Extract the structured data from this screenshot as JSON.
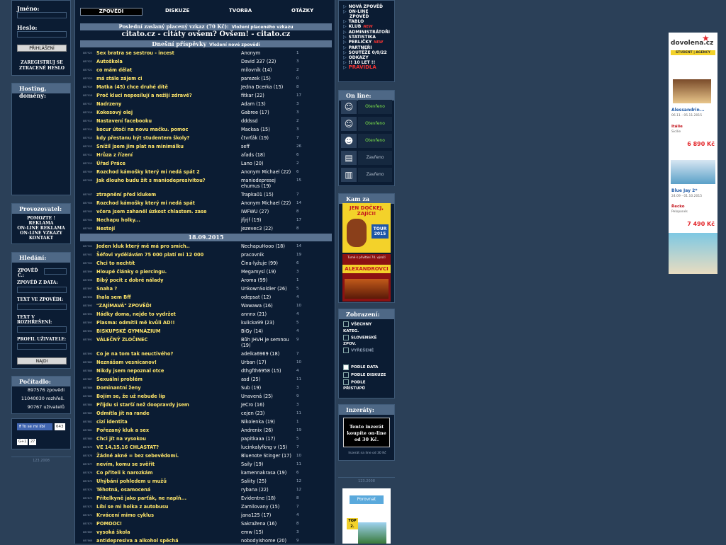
{
  "login": {
    "name_label": "Jméno:",
    "pass_label": "Heslo:",
    "login_btn": "PŘIHLÁŠENÍ",
    "register": "ZAREGISTRUJ SE",
    "forgot": "ZTRACENÉ HESLO"
  },
  "hosting": {
    "title": "Hosting,",
    "title2": "domény:"
  },
  "provider": {
    "title": "Provozovatel:",
    "links": [
      "POMOZTE !",
      "REKLAMA",
      "ON-LINE REKLAMA",
      "ON-LINE VZKAZY",
      "KONTAKT"
    ]
  },
  "search": {
    "title": "Hledání:",
    "f1": "ZPOVĚĎ Č.:",
    "f2": "ZPOVĚĎ Z DATA:",
    "f3": "TEXT VE ZPOVĚDI:",
    "f4": "TEXT V ROZHŘEŠENÍ:",
    "f5": "PROFIL UŽIVATELE:",
    "btn": "NAJDI"
  },
  "counter": {
    "title": "Počítadlo:",
    "c1": "897576 zpovědi",
    "c2": "11040030 rozhřeš.",
    "c3": "90767 uživatelů"
  },
  "social": {
    "fb": "To se mi líbí",
    "fb_count": "643",
    "gplus": "G+1",
    "gplus_count": "27"
  },
  "left_footer": "123.2008",
  "nav": {
    "tabs": [
      "ZPOVĚDI",
      "DISKUZE",
      "TVORBA",
      "OTÁZKY"
    ]
  },
  "paid": {
    "title": "Poslední zaslaný placený vzkaz (70 Kč):",
    "insert": "Vložení placeného vzkazu",
    "text": "citato.cz - citáty ovšem? Ovšem! - citato.cz"
  },
  "today": {
    "title": "Dnešní příspěvky",
    "insert": "Vložení nové zpovědi"
  },
  "date_sep": "18.09.2015",
  "rows1": [
    {
      "id": "887923",
      "t": "Sex bratra se sestrou - incest",
      "a": "Anonym",
      "c": "1"
    },
    {
      "id": "887922",
      "t": "Autoškola",
      "a": "David 337 (22)",
      "c": "3"
    },
    {
      "id": "887921",
      "t": "co mám dělat",
      "a": "milovník (14)",
      "c": "2"
    },
    {
      "id": "887920",
      "t": "má stále zájem ci",
      "a": "parezek (15)",
      "c": "0"
    },
    {
      "id": "887919",
      "t": "Matka (45) chce druhé dítě",
      "a": "Jedna Dcerka (15)",
      "c": "8"
    },
    {
      "id": "887918",
      "t": "Proč kluci neposílují a nežijí zdravě?",
      "a": "fitkar (22)",
      "c": "17"
    },
    {
      "id": "887917",
      "t": "Nadrzeny",
      "a": "Adam (13)",
      "c": "3"
    },
    {
      "id": "887916",
      "t": "Kokosový olej",
      "a": "Gabree (17)",
      "c": "3"
    },
    {
      "id": "887915",
      "t": "Nastavení facebooku",
      "a": "dddssd",
      "c": "2"
    },
    {
      "id": "887914",
      "t": "kocur útočí na novu mačku. pomoc",
      "a": "Mackaa (15)",
      "c": "3"
    },
    {
      "id": "887913",
      "t": "kdy přestanu být studentem školy?",
      "a": "čtvrťák (19)",
      "c": "7"
    },
    {
      "id": "887912",
      "t": "Snížil jsem jim plat na minimálku",
      "a": "seff",
      "c": "26"
    },
    {
      "id": "887911",
      "t": "Hrůza z řízení",
      "a": "afads (18)",
      "c": "6"
    },
    {
      "id": "887910",
      "t": "Úřad Práce",
      "a": "Lano (20)",
      "c": "2"
    },
    {
      "id": "887909",
      "t": "Rozchod kámošky který mi nedá spát 2",
      "a": "Anonym Michael (22)",
      "c": "6"
    },
    {
      "id": "887908",
      "t": "Jak dlouho budu žít s maniodepresivitou?",
      "a": "maniodepresej",
      "a2": "ehumus (19)",
      "c": "15"
    },
    {
      "id": "887907",
      "t": "ztrapnění před klukem",
      "a": "Trapka01 (15)",
      "c": "7"
    },
    {
      "id": "887906",
      "t": "Rozchod kámošky který mi nedá spát",
      "a": "Anonym Michael (22)",
      "c": "14"
    },
    {
      "id": "887905",
      "t": "včera jsem zahaněl úzkost chlastem. zase",
      "a": "IWFWU (27)",
      "c": "8"
    },
    {
      "id": "887904",
      "t": "Nechapu holky...",
      "a": "jfjrjf (19)",
      "c": "17"
    },
    {
      "id": "887903",
      "t": "Nestojí",
      "a": "Jezevec3 (22)",
      "c": "8"
    }
  ],
  "rows2": [
    {
      "id": "887902",
      "t": "Jeden kluk který mě má pro smích..",
      "a": "NechapuHooo (18)",
      "c": "14"
    },
    {
      "id": "887901",
      "t": "Šéfovi vydělávám 75 000 platí mi 12 000",
      "a": "pracovnik",
      "c": "19"
    },
    {
      "id": "887900",
      "t": "Chci to nechtít",
      "a": "Čina-lyžuje (99)",
      "c": "6"
    },
    {
      "id": "887899",
      "t": "Hloupé články o piercingu.",
      "a": "Megamysl (19)",
      "c": "3"
    },
    {
      "id": "887898",
      "t": "Bibý pocit z dobré nálady",
      "a": "Aroma (99)",
      "c": "1"
    },
    {
      "id": "887897",
      "t": "Snaha ?",
      "a": "UnkownSoldier (26)",
      "c": "5"
    },
    {
      "id": "887896",
      "t": "Ihala sem Bff",
      "a": "odepsat (12)",
      "c": "4"
    },
    {
      "id": "887895",
      "t": "\"ZAJÍMAVÁ\" ZPOVĚĎ!",
      "a": "Wawawa (16)",
      "c": "10"
    },
    {
      "id": "887894",
      "t": "Hádky doma, nejde to vydržet",
      "a": "annnx (21)",
      "c": "4"
    },
    {
      "id": "887893",
      "t": "Plasma: odmítli mě kvůli AD!!",
      "a": "kulicka99 (23)",
      "c": "5"
    },
    {
      "id": "887892",
      "t": "BISKUPSKÉ GYMNÁZIUM",
      "a": "BiGy (14)",
      "c": "4"
    },
    {
      "id": "887891",
      "t": "VÁLEČNÝ ZLOČINEC",
      "a": "Bůh JHVH je semnou",
      "a2": "(19)",
      "c": "9"
    },
    {
      "id": "887890",
      "t": "Co je na tom tak neuctivého?",
      "a": "adelka6969 (18)",
      "c": "7"
    },
    {
      "id": "887889",
      "t": "Neznášam vesnicanov!",
      "a": "Urban (17)",
      "c": "10"
    },
    {
      "id": "887888",
      "t": "Nikdy jsem nepoznal otce",
      "a": "dthgfth6958 (15)",
      "c": "4"
    },
    {
      "id": "887887",
      "t": "Sexuální problém",
      "a": "asd (25)",
      "c": "11"
    },
    {
      "id": "887886",
      "t": "Dominantní ženy",
      "a": "Sub (19)",
      "c": "3"
    },
    {
      "id": "887885",
      "t": "Bojím se, že už nebude líp",
      "a": "Unavená (25)",
      "c": "9"
    },
    {
      "id": "887884",
      "t": "Přijdu si starší než doopravdy jsem",
      "a": "JeCro (16)",
      "c": "3"
    },
    {
      "id": "887883",
      "t": "Odmítla jít na rande",
      "a": "cejen (23)",
      "c": "11"
    },
    {
      "id": "887882",
      "t": "cizí identita",
      "a": "Nikolenka (19)",
      "c": "1"
    },
    {
      "id": "887881",
      "t": "Pořezaný kluk a sex",
      "a": "Andrenix (26)",
      "c": "19"
    },
    {
      "id": "887880",
      "t": "Chci jít na vysokou",
      "a": "papitkaaa (17)",
      "c": "5"
    },
    {
      "id": "887879",
      "t": "VE 14,15,16 CHLASTAT?",
      "a": "lucinkalyfkng v (15)",
      "c": "7"
    },
    {
      "id": "887878",
      "t": "Žádné akné = bez sebevědomí.",
      "a": "Bluenote Stinger (17)",
      "c": "10"
    },
    {
      "id": "887877",
      "t": "nevím, komu se svěřit",
      "a": "Saily (19)",
      "c": "11"
    },
    {
      "id": "887876",
      "t": "Co přiteli k narozkám",
      "a": "kamennakrasa (19)",
      "c": "6"
    },
    {
      "id": "887875",
      "t": "Uhýbání pohledem u mužů",
      "a": "Saliity (25)",
      "c": "12"
    },
    {
      "id": "887874",
      "t": "Těhotná, osamocená",
      "a": "rybana (22)",
      "c": "12"
    },
    {
      "id": "887873",
      "t": "Přítelkyně jako parťák, ne naplň...",
      "a": "Evidentne (18)",
      "c": "8"
    },
    {
      "id": "887872",
      "t": "Líbí se mi holka z autobusu",
      "a": "Zamilovany (15)",
      "c": "7"
    },
    {
      "id": "887871",
      "t": "Krvácení mimo cyklus",
      "a": "jana125 (17)",
      "c": "4"
    },
    {
      "id": "887870",
      "t": "POMOOC!",
      "a": "Sakražena (16)",
      "c": "8"
    },
    {
      "id": "887869",
      "t": "vysoká škola",
      "a": "emw (15)",
      "c": "3"
    },
    {
      "id": "887868",
      "t": "antidepresiva a alkohol spěchá",
      "a": "nobodyishome (20)",
      "c": "9"
    }
  ],
  "right_nav": [
    {
      "l": "NOVÁ ZPOVĚĎ",
      "arrow": true
    },
    {
      "l": "ON-LINE",
      "arrow": true
    },
    {
      "l": "ZPOVĚĎ",
      "arrow": false
    },
    {
      "l": "TABLO",
      "arrow": true
    },
    {
      "l": "KLUB",
      "arrow": true,
      "new": "NEW"
    },
    {
      "l": "ADMINISTRÁTOŘI",
      "arrow": true
    },
    {
      "l": "STATISTIKA",
      "arrow": true
    },
    {
      "l": "PERLIČKY",
      "arrow": true,
      "new": "NEW"
    },
    {
      "l": "PARTNEŘI",
      "arrow": true
    },
    {
      "l": "SOUTĚŽE 0/0/22",
      "arrow": true
    },
    {
      "l": "ODKAZY",
      "arrow": true
    },
    {
      "l": "!! 10 LET !!",
      "arrow": true
    },
    {
      "l": "PRAVIDLA",
      "arrow": true,
      "red": true
    }
  ],
  "online": {
    "title": "On line:",
    "rows": [
      {
        "s": "Otevřeno",
        "open": true
      },
      {
        "s": "Otevřeno",
        "open": true
      },
      {
        "s": "Otevřeno",
        "open": true
      },
      {
        "s": "Zavřeno",
        "open": false
      },
      {
        "s": "Zavřeno",
        "open": false
      }
    ]
  },
  "kamza": {
    "title": "Kam za",
    "ad1a": "JEN DOČKEJ, ZAJÍCI!",
    "ad1b": "TOUR 2015",
    "ad2a": "ALEXANDROVCI",
    "ad2b": "Turné k přivítání 70. výročí"
  },
  "display": {
    "title": "Zobrazení:",
    "all": "VŠECHNY",
    "kateg": "KATEG.",
    "sk": "SLOVENSKÉ",
    "zpov": "ZPOV.",
    "vyr": "VYŘEŠENÉ",
    "by_date": "PODLE DATA",
    "by_disc": "PODLE DISKUZE",
    "by_acc": "PODLE",
    "prist": "PŘÍSTUPŮ"
  },
  "ads": {
    "title": "Inzeráty:",
    "box": "Tento inzerát koupíte on-line od 30 Kč.",
    "note": "Inzerát na line od 30 Kč"
  },
  "right_footer": "123.2008",
  "porovnat": "Porovnat",
  "top2": "TOP 2.",
  "dovolena": {
    "logo": "dovolena.cz",
    "sub": "STUDENT | AGENCY",
    "o1t": "Alessandrin...",
    "o1d": "06.11 - 05.11.2015",
    "o1c": "Itálie",
    "o1r": "Sicílie",
    "o1p": "6 890 Kč",
    "o2t": "Blue Jay 2*",
    "o2d": "24.09 - 01.10.2015",
    "o2c": "Řecko",
    "o2r": "Peloponés",
    "o2p": "7 490 Kč"
  }
}
